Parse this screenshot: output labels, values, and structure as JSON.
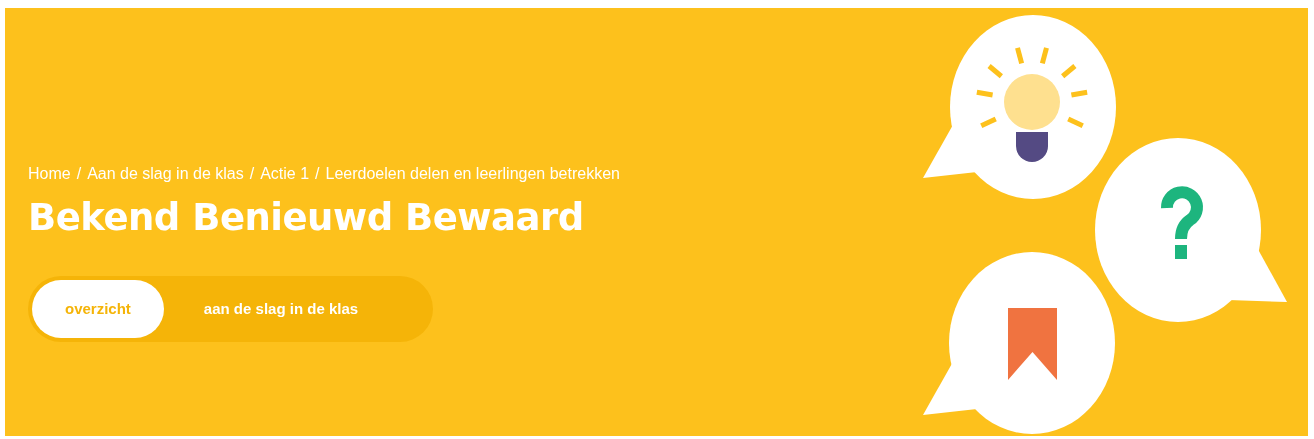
{
  "breadcrumb": {
    "items": [
      {
        "label": "Home"
      },
      {
        "label": "Aan de slag in de klas"
      },
      {
        "label": "Actie 1"
      },
      {
        "label": "Leerdoelen delen en leerlingen betrekken"
      }
    ],
    "separators": [
      "/",
      "/",
      "/"
    ]
  },
  "title": "Bekend Benieuwd Bewaard",
  "tabs": [
    {
      "label": "overzicht",
      "selected": true
    },
    {
      "label": "aan de slag in de klas",
      "selected": false
    }
  ]
}
